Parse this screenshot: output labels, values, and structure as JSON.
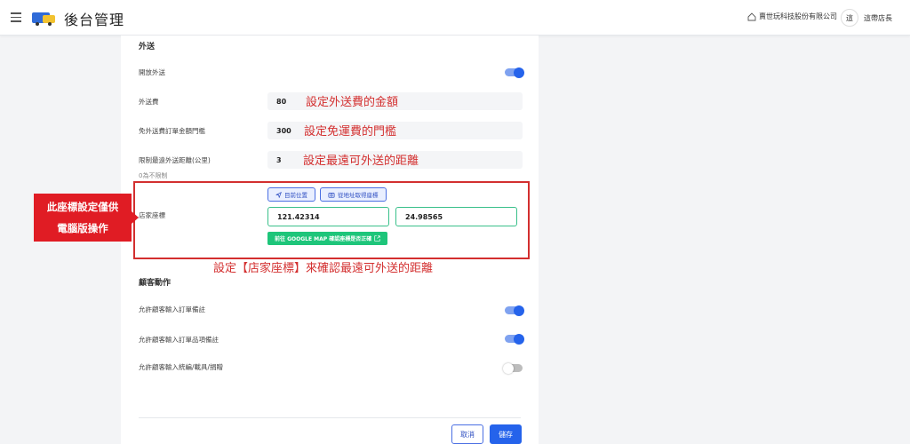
{
  "header": {
    "title": "後台管理",
    "company": "賣世玩科技股份有限公司",
    "avatar_initial": "這",
    "user_name": "這帶店長"
  },
  "delivery": {
    "section_title": "外送",
    "enable_label": "開放外送",
    "enable_on": true,
    "fee_label": "外送費",
    "fee_value": "80",
    "fee_annotation": "設定外送費的金額",
    "free_threshold_label": "免外送費訂單金額門檻",
    "free_threshold_value": "300",
    "free_threshold_annotation": "設定免運費的門檻",
    "max_distance_label": "限制最遠外送距離(公里)",
    "max_distance_value": "3",
    "max_distance_annotation": "設定最遠可外送的距離",
    "max_distance_hint": "0為不限制"
  },
  "store_coords": {
    "label": "店家座標",
    "current_location_button": "目前位置",
    "from_address_button": "從地址取得座標",
    "longitude": "121.42314",
    "latitude": "24.98565",
    "google_map_button": "前往 GOOGLE MAP 確認座標是否正確",
    "annotation": "設定【店家座標】來確認最遠可外送的距離",
    "side_note_line1": "此座標設定僅供",
    "side_note_line2": "電腦版操作"
  },
  "customer": {
    "section_title": "顧客動作",
    "order_note_label": "允許顧客輸入訂單備註",
    "order_note_on": true,
    "item_note_label": "允許顧客輸入訂單品項備註",
    "item_note_on": true,
    "tableware_label": "允許顧客輸入統編/載具/捐贈",
    "tableware_on": false
  },
  "footer": {
    "cancel_label": "取消",
    "save_label": "儲存"
  },
  "colors": {
    "primary": "#2563eb",
    "annotation_red": "#d32f2f",
    "confirm_green": "#1ec57a"
  }
}
